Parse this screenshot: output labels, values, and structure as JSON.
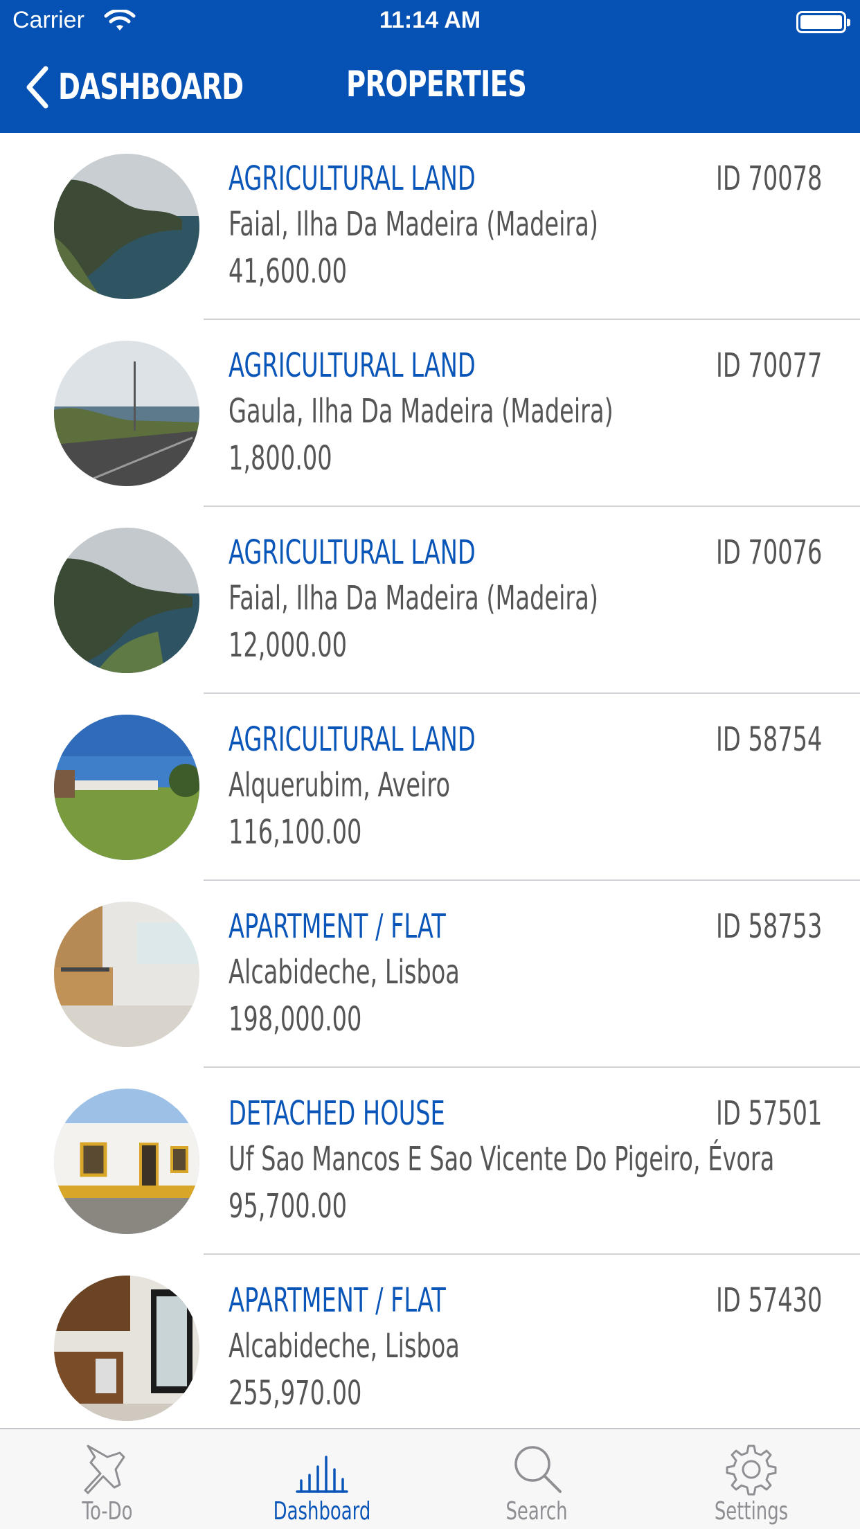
{
  "status_bar": {
    "carrier": "Carrier",
    "time": "11:14 AM"
  },
  "nav": {
    "back_label": "DASHBOARD",
    "title": "PROPERTIES"
  },
  "properties": [
    {
      "type": "AGRICULTURAL LAND",
      "id": "ID 70078",
      "location": "Faial, Ilha Da Madeira (Madeira)",
      "price": "41,600.00"
    },
    {
      "type": "AGRICULTURAL LAND",
      "id": "ID 70077",
      "location": "Gaula, Ilha Da Madeira (Madeira)",
      "price": "1,800.00"
    },
    {
      "type": "AGRICULTURAL LAND",
      "id": "ID 70076",
      "location": "Faial, Ilha Da Madeira (Madeira)",
      "price": "12,000.00"
    },
    {
      "type": "AGRICULTURAL LAND",
      "id": "ID 58754",
      "location": "Alquerubim, Aveiro",
      "price": "116,100.00"
    },
    {
      "type": "APARTMENT / FLAT",
      "id": "ID 58753",
      "location": "Alcabideche, Lisboa",
      "price": "198,000.00"
    },
    {
      "type": "DETACHED HOUSE",
      "id": "ID 57501",
      "location": "Uf Sao Mancos E Sao Vicente Do Pigeiro, Évora",
      "price": "95,700.00"
    },
    {
      "type": "APARTMENT / FLAT",
      "id": "ID 57430",
      "location": "Alcabideche, Lisboa",
      "price": "255,970.00"
    }
  ],
  "tabs": [
    {
      "label": "To-Do",
      "icon": "pin-icon",
      "active": false
    },
    {
      "label": "Dashboard",
      "icon": "bar-chart-icon",
      "active": true
    },
    {
      "label": "Search",
      "icon": "search-icon",
      "active": false
    },
    {
      "label": "Settings",
      "icon": "gear-icon",
      "active": false
    }
  ],
  "colors": {
    "brand": "#0551b4",
    "accent": "#0a55b8",
    "text": "#555555",
    "tab_inactive": "#8e8e93"
  }
}
